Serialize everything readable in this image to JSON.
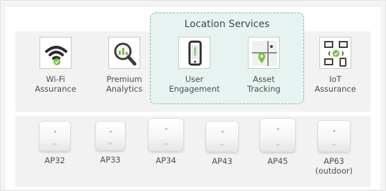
{
  "location_services": {
    "title": "Location Services"
  },
  "features": [
    {
      "name": "wifi-assurance",
      "line1": "Wi-Fi",
      "line2": "Assurance",
      "icon": "wifi-check-icon"
    },
    {
      "name": "premium-analytics",
      "line1": "Premium",
      "line2": "Analytics",
      "icon": "magnifier-chart-icon"
    },
    {
      "name": "user-engagement",
      "line1": "User",
      "line2": "Engagement",
      "icon": "smartphone-icon"
    },
    {
      "name": "asset-tracking",
      "line1": "Asset",
      "line2": "Tracking",
      "icon": "map-pin-icon"
    },
    {
      "name": "iot-assurance",
      "line1": "IoT",
      "line2": "Assurance",
      "icon": "connected-devices-icon"
    }
  ],
  "access_points": [
    {
      "model": "AP32",
      "note": ""
    },
    {
      "model": "AP33",
      "note": ""
    },
    {
      "model": "AP34",
      "note": ""
    },
    {
      "model": "AP43",
      "note": ""
    },
    {
      "model": "AP45",
      "note": ""
    },
    {
      "model": "AP63",
      "note": "(outdoor)"
    }
  ],
  "colors": {
    "accent_green": "#7cc242",
    "location_box_fill": "#e6f3f1",
    "location_box_border": "#74b9b1"
  }
}
